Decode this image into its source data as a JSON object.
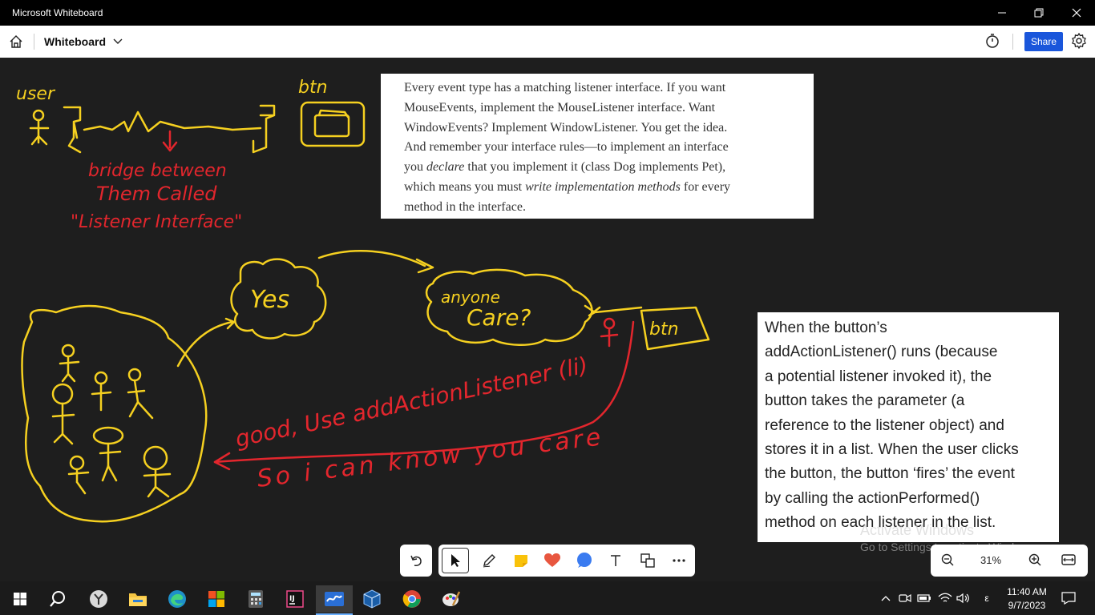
{
  "window": {
    "title": "Microsoft Whiteboard",
    "controls": [
      "minimize",
      "restore",
      "close"
    ]
  },
  "appbar": {
    "board_name": "Whiteboard",
    "share_label": "Share",
    "icons": [
      "home-icon",
      "chevron-down-icon",
      "timer-icon",
      "gear-icon"
    ]
  },
  "canvas": {
    "ink_labels": {
      "user": "user",
      "btn_top": "btn",
      "bridge_line1": "bridge between",
      "bridge_line2": "Them Called",
      "bridge_line3": "\"Listener Interface\"",
      "yes": "Yes",
      "anyone_line1": "anyone",
      "anyone_line2": "Care?",
      "btn_right": "btn",
      "add_line1": "good, Use addActionListener (li)",
      "add_line2": "So i can know you care"
    },
    "note_book": {
      "line1": "Every event type has a matching listener interface. If you want",
      "line2": "MouseEvents, implement the MouseListener interface. Want",
      "line3": "WindowEvents? Implement WindowListener. You get the idea.",
      "line4": "And remember your interface rules—to implement an interface",
      "line5_a": "you ",
      "line5_em": "declare",
      "line5_b": " that you implement it (class Dog implements Pet),",
      "line6_a": "which means you must ",
      "line6_em": "write implementation methods",
      "line6_b": " for every",
      "line7": "method in the interface."
    },
    "note_button": {
      "lines": [
        "When the button’s",
        "addActionListener() runs (because",
        "a potential listener invoked it), the",
        "button takes the parameter (a",
        "reference to the listener object) and",
        "stores it in a list. When the user clicks",
        "the button, the button ‘fires’ the event",
        "by calling the actionPerformed()",
        "method on each listener in the list."
      ]
    },
    "watermark": {
      "line1": "Activate Windows",
      "line2": "Go to Settings to activate Windows."
    }
  },
  "toolbar": {
    "undo_icon": "undo-icon",
    "tools": [
      "select-icon",
      "pen-icon",
      "sticky-note-icon",
      "reaction-icon",
      "shapes-icon",
      "text-icon",
      "copy-icon",
      "more-icon"
    ]
  },
  "zoom": {
    "value": "31%",
    "icons": [
      "zoom-out-icon",
      "zoom-in-icon",
      "fit-icon"
    ]
  },
  "taskbar": {
    "apps": [
      "start",
      "search",
      "app-y",
      "file-explorer",
      "edge",
      "windows-store",
      "calculator",
      "intellij",
      "whiteboard",
      "virtualbox",
      "chrome",
      "paint"
    ],
    "tray_lang": "ε",
    "time": "11:40 AM",
    "date": "9/7/2023"
  },
  "colors": {
    "ink_yellow": "#f5d020",
    "ink_red": "#e3262d",
    "share_blue": "#1a56db",
    "canvas_bg": "#1e1e1e"
  }
}
